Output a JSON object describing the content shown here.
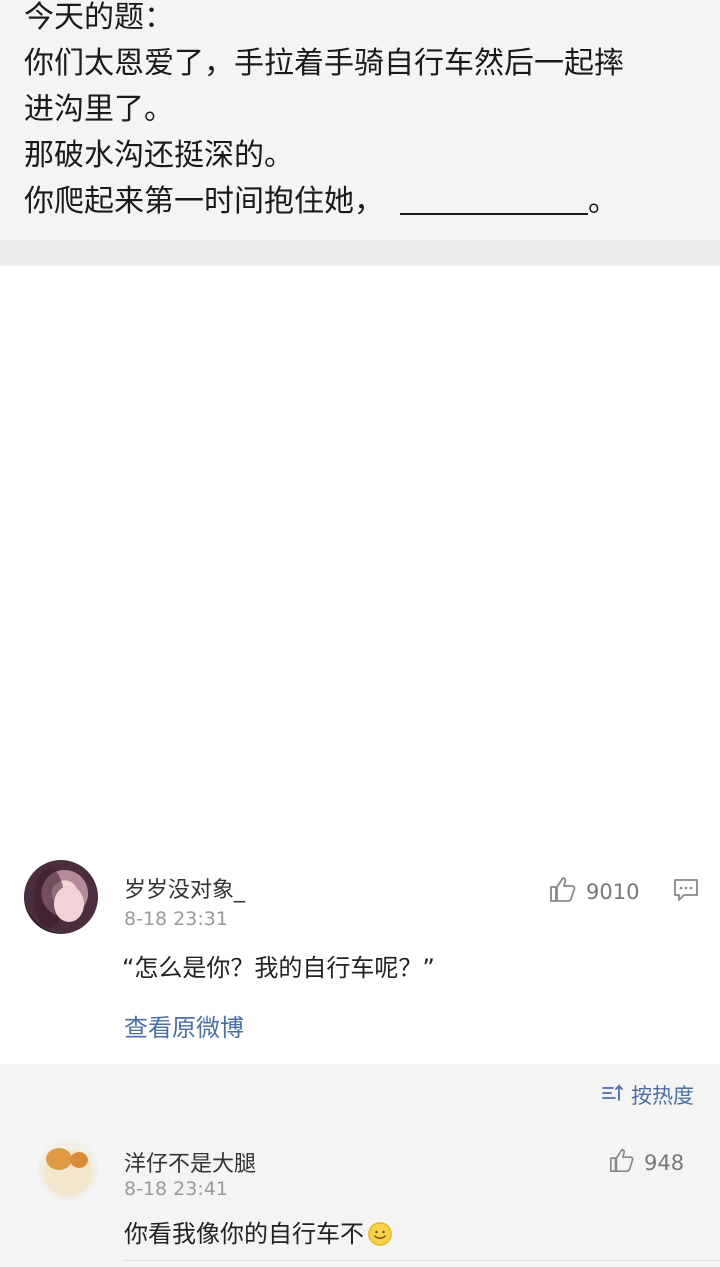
{
  "post": {
    "lines": [
      "今天的题：",
      "你们太恩爱了，手拉着手骑自行车然后一起摔",
      "进沟里了。",
      "那破水沟还挺深的。",
      "你爬起来第一时间抱住她，"
    ],
    "line5_end": "。"
  },
  "top_comment": {
    "username": "岁岁没对象_",
    "time": "8-18 23:31",
    "likes": "9010",
    "text": "“怎么是你？我的自行车呢？”",
    "view_original": "查看原微博"
  },
  "replies": {
    "sort_label": "按热度",
    "items": [
      {
        "username": "洋仔不是大腿",
        "time": "8-18 23:41",
        "likes": "948",
        "text": "你看我像你的自行车不"
      }
    ]
  },
  "icons": {
    "like": "thumbs-up-icon",
    "comment": "comment-icon",
    "sort": "sort-icon",
    "emoji": "smile-emoji-icon"
  },
  "colors": {
    "link": "#4a6fa5",
    "meta": "#9a9a9a",
    "post_bg": "#f4f4f4"
  }
}
